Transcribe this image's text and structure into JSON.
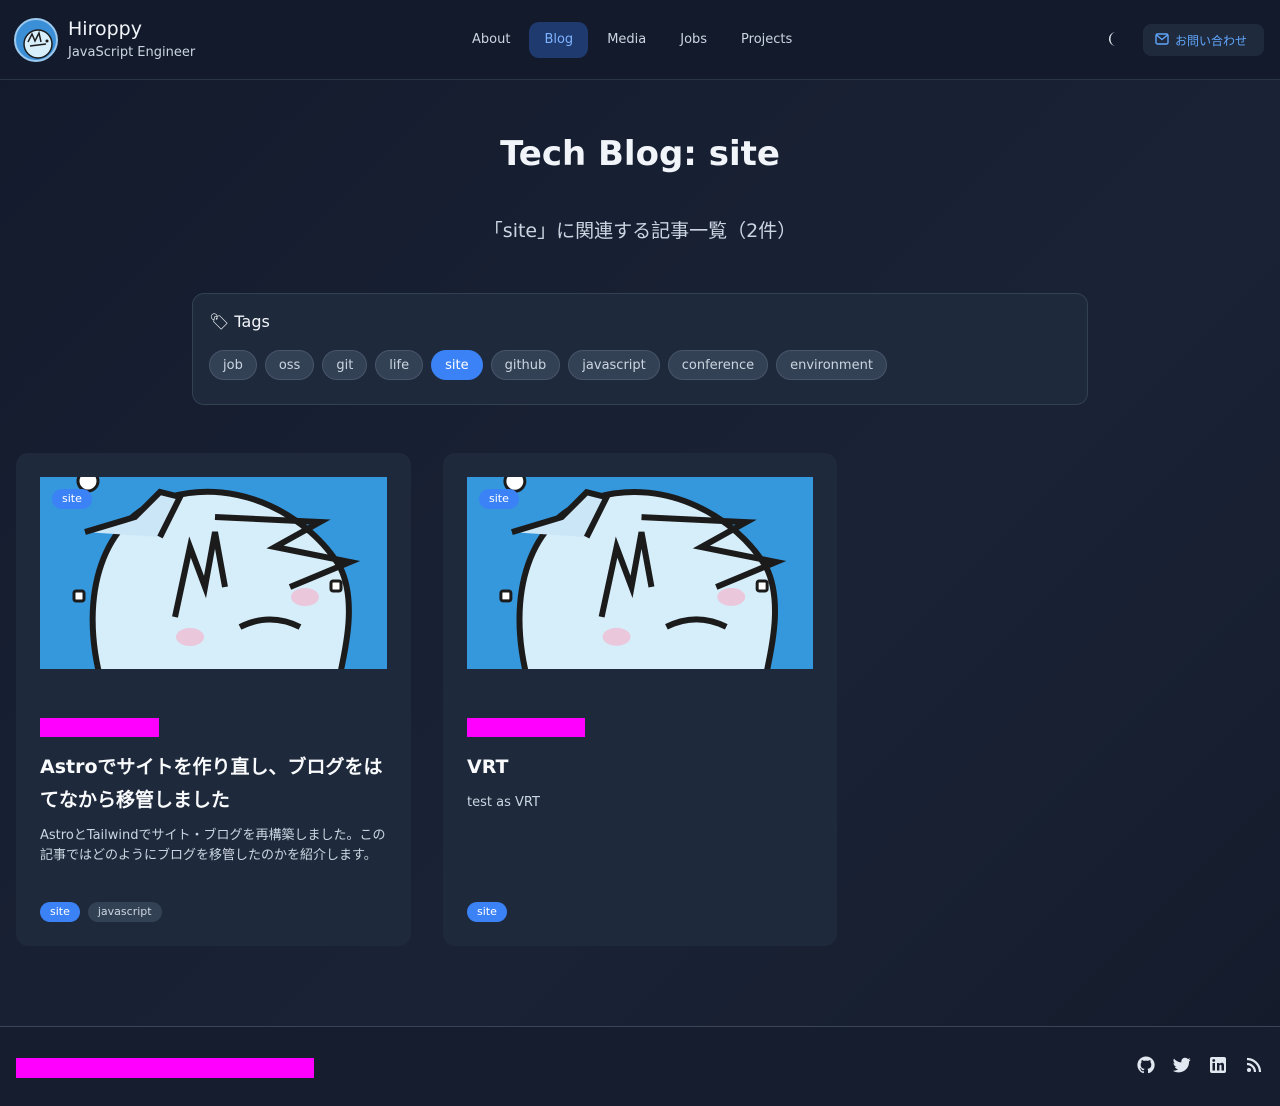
{
  "header": {
    "brand_name": "Hiroppy",
    "brand_subtitle": "JavaScript Engineer",
    "nav": [
      {
        "label": "About",
        "active": false
      },
      {
        "label": "Blog",
        "active": true
      },
      {
        "label": "Media",
        "active": false
      },
      {
        "label": "Jobs",
        "active": false
      },
      {
        "label": "Projects",
        "active": false
      }
    ],
    "theme_toggle_icon": "moon-icon",
    "contact_label": "お問い合わせ",
    "contact_icon": "mail-icon"
  },
  "page": {
    "title": "Tech Blog: site",
    "subtitle": "「site」に関連する記事一覧（2件）"
  },
  "tags_panel": {
    "heading": "🏷 Tags",
    "tags": [
      {
        "label": "job",
        "active": false
      },
      {
        "label": "oss",
        "active": false
      },
      {
        "label": "git",
        "active": false
      },
      {
        "label": "life",
        "active": false
      },
      {
        "label": "site",
        "active": true
      },
      {
        "label": "github",
        "active": false
      },
      {
        "label": "javascript",
        "active": false
      },
      {
        "label": "conference",
        "active": false
      },
      {
        "label": "environment",
        "active": false
      }
    ]
  },
  "articles": [
    {
      "badge": "site",
      "title": "Astroでサイトを作り直し、ブログをはてなから移管しました",
      "description": "AstroとTailwindでサイト・ブログを再構築しました。この記事ではどのようにブログを移管したのかを紹介します。",
      "tags": [
        {
          "label": "site",
          "active": true
        },
        {
          "label": "javascript",
          "active": false
        }
      ]
    },
    {
      "badge": "site",
      "title": "VRT",
      "description": "test as VRT",
      "tags": [
        {
          "label": "site",
          "active": true
        }
      ]
    }
  ],
  "colors": {
    "background": "#141c2e",
    "accent": "#3b82f6",
    "redaction": "#ff00ff"
  },
  "footer": {
    "social_icons": [
      "github-icon",
      "twitter-icon",
      "linkedin-icon",
      "rss-icon"
    ]
  }
}
